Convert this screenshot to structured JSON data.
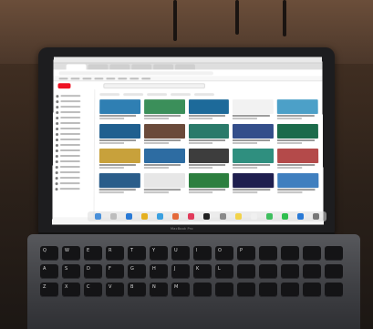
{
  "scene": {
    "device": "laptop",
    "brand_text": "MacBook Pro",
    "screen_app": "YouTube in Chrome",
    "colors": {
      "bezel": "#1d1d1f",
      "chassis": "#4a4b4f",
      "youtube_red": "#ee1122",
      "background": "#2b1f16"
    }
  },
  "youtube": {
    "thumbnail_colors": [
      "#2f7fb3",
      "#3b8f5a",
      "#1d6a9a",
      "#f2f2f2",
      "#4ca0c8",
      "#1f5f8f",
      "#6a4a3a",
      "#2a7a6a",
      "#334e8a",
      "#1b6b4b",
      "#c8a13b",
      "#2d6ca2",
      "#3d3d3d",
      "#2f8f7f",
      "#b44a4a",
      "#2a5d8a",
      "#e7e7e7",
      "#2c7f3f",
      "#1f1f4f",
      "#3f7fbf"
    ]
  },
  "dock": {
    "icons": [
      "finder-icon",
      "launchpad-icon",
      "safari-icon",
      "chrome-icon",
      "mail-icon",
      "photos-icon",
      "music-icon",
      "terminal-icon",
      "settings-icon",
      "notes-icon",
      "calendar-icon",
      "messages-icon",
      "facetime-icon",
      "appstore-icon",
      "trash-icon"
    ],
    "icon_colors": [
      "#4a90d9",
      "#bdbdbd",
      "#2a7ad6",
      "#e5b020",
      "#3aa0e0",
      "#e46a3a",
      "#e13b5b",
      "#222222",
      "#8a8a8a",
      "#f2d34b",
      "#f0f0f0",
      "#3fbf5f",
      "#2fbf4f",
      "#2a7ad6",
      "#777777"
    ]
  },
  "keyboard": {
    "keys": [
      "Q",
      "W",
      "E",
      "R",
      "T",
      "Y",
      "U",
      "I",
      "O",
      "P",
      "",
      "",
      "",
      "",
      "A",
      "S",
      "D",
      "F",
      "G",
      "H",
      "J",
      "K",
      "L",
      "",
      "",
      "",
      "",
      "",
      "Z",
      "X",
      "C",
      "V",
      "B",
      "N",
      "M",
      "",
      "",
      "",
      "",
      "",
      "",
      ""
    ]
  }
}
